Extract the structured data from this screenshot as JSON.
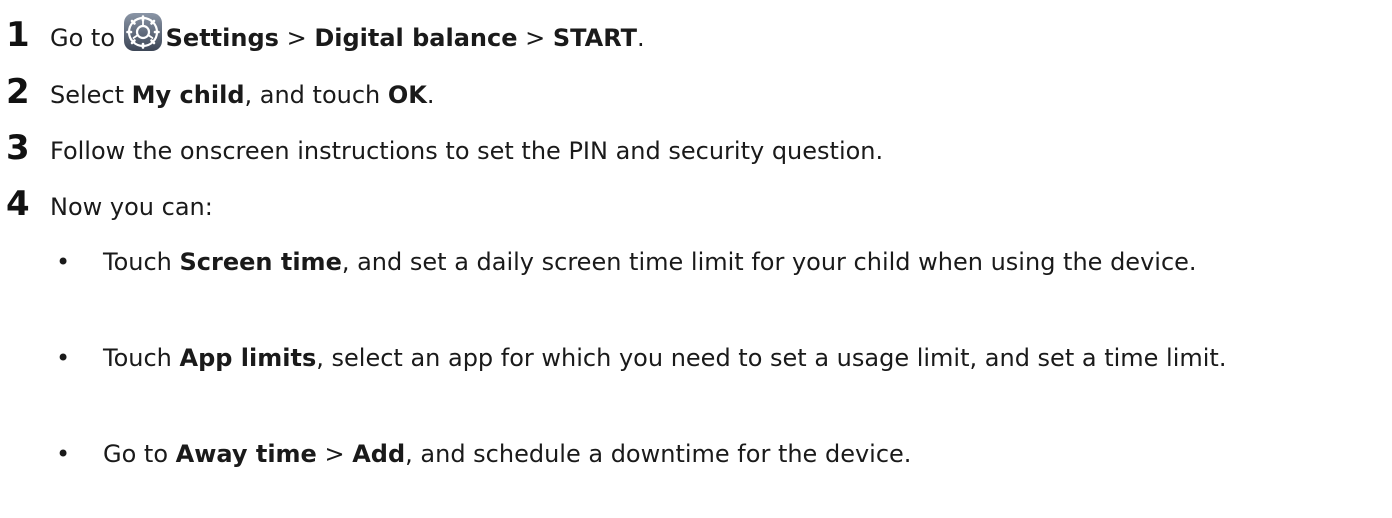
{
  "steps": [
    {
      "number": "1",
      "parts": [
        "Go to ",
        "Settings",
        " > ",
        "Digital balance",
        " > ",
        "START",
        "."
      ]
    },
    {
      "number": "2",
      "parts": [
        "Select ",
        "My child",
        ", and touch ",
        "OK",
        "."
      ]
    },
    {
      "number": "3",
      "text": "Follow the onscreen instructions to set the PIN and security question."
    },
    {
      "number": "4",
      "text": "Now you can:"
    }
  ],
  "bullets": [
    {
      "marker": "•",
      "parts": [
        "Touch ",
        "Screen time",
        ", and set a daily screen time limit for your child when using the device."
      ]
    },
    {
      "marker": "•",
      "parts": [
        "Touch ",
        "App limits",
        ", select an app for which you need to set a usage limit, and set a time limit."
      ]
    },
    {
      "marker": "•",
      "parts": [
        "Go to ",
        "Away time",
        " > ",
        "Add",
        ", and schedule a downtime for the device."
      ]
    }
  ],
  "icons": {
    "settings": "settings-gear-icon"
  },
  "colors": {
    "text": "#1a1a1a",
    "icon_bg": "#4f5b6e"
  }
}
